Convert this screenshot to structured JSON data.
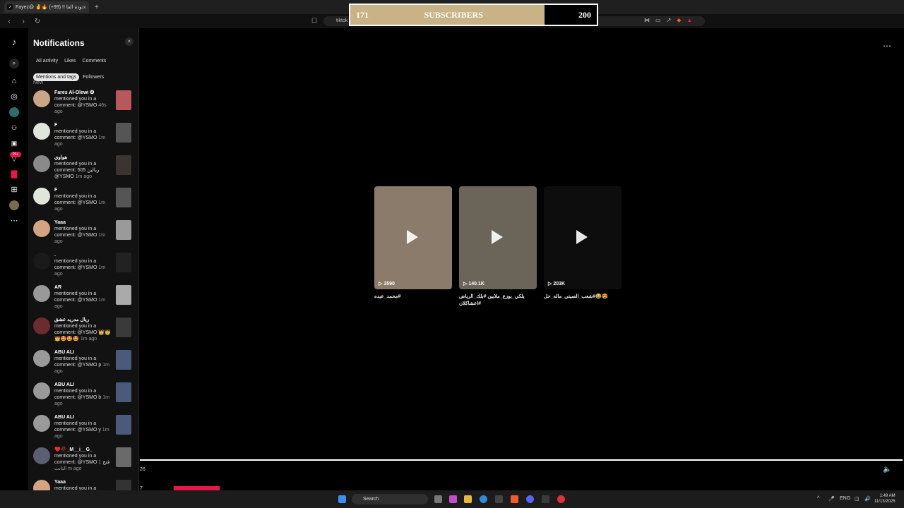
{
  "browser": {
    "tab_title": "Fayez@ ✌️🔥 عودة الفا !! (99+)",
    "url": "tiktok",
    "tab_icon": "tiktok-icon",
    "new_tab": "+",
    "close": "×"
  },
  "subscriber_banner": {
    "current": "171",
    "label": "SUBSCRIBERS",
    "goal": "200",
    "progress": 0.855,
    "fill_color": "#c9b285"
  },
  "notifications": {
    "title": "Notifications",
    "close_label": "×",
    "filters": [
      "All activity",
      "Likes",
      "Comments",
      "Mentions and tags",
      "Followers"
    ],
    "active_filter": "Mentions and tags",
    "section": "New",
    "items": [
      {
        "name": "Fares Al-Olewi ✪",
        "text": "mentioned you in a comment: @YSMO",
        "time": "46s ago",
        "avatar_color": "#c9a686",
        "thumb_color": "#b8585c"
      },
      {
        "name": "F",
        "text": "mentioned you in a comment: @YSMO",
        "time": "1m ago",
        "avatar_color": "#e0e6dc",
        "thumb_color": "#555555"
      },
      {
        "name": "هواوي",
        "text": "mentioned you in a comment: 505 ريالين @YSMO",
        "time": "1m ago",
        "avatar_color": "#8a8a8a",
        "thumb_color": "#3a3530"
      },
      {
        "name": "F",
        "text": "mentioned you in a comment: @YSMO",
        "time": "1m ago",
        "avatar_color": "#e0e6dc",
        "thumb_color": "#555555"
      },
      {
        "name": "Yaaa",
        "text": "mentioned you in a comment: @YSMO",
        "time": "1m ago",
        "avatar_color": "#d4a480",
        "thumb_color": "#9a9a9a"
      },
      {
        "name": ".",
        "text": "mentioned you in a comment: @YSMO",
        "time": "1m ago",
        "avatar_color": "#1a1a1a",
        "thumb_color": "#222222"
      },
      {
        "name": "AR",
        "text": "mentioned you in a comment: @YSMO",
        "time": "1m ago",
        "avatar_color": "#999999",
        "thumb_color": "#aaaaaa"
      },
      {
        "name": "ريال مدريد عشق",
        "text": "mentioned you in a comment: @YSMO 👑👑👑🤩🤩🤩",
        "time": "1m ago",
        "avatar_color": "#6a2c2c",
        "thumb_color": "#3a3a3a"
      },
      {
        "name": "ABU ALI",
        "text": "mentioned you in a comment: @YSMO p",
        "time": "1m ago",
        "avatar_color": "#9a9a9a",
        "thumb_color": "#4a5a7a"
      },
      {
        "name": "ABU ALI",
        "text": "mentioned you in a comment: @YSMO b",
        "time": "1m ago",
        "avatar_color": "#9a9a9a",
        "thumb_color": "#4a5a7a"
      },
      {
        "name": "ABU ALI",
        "text": "mentioned you in a comment: @YSMO y",
        "time": "1m ago",
        "avatar_color": "#9a9a9a",
        "thumb_color": "#4a5a7a"
      },
      {
        "name": "♥️🥀_M__i__G_",
        "text": "mentioned you in a comment: @YSMO فتح",
        "time": "1 الثانث m ago",
        "avatar_color": "#5a6070",
        "thumb_color": "#6a6a6a"
      },
      {
        "name": "Yaaa",
        "text": "mentioned you in a",
        "time": "",
        "avatar_color": "#d4a480",
        "thumb_color": "#333333"
      }
    ]
  },
  "rail_icons": [
    "tiktok-logo-icon",
    "search-icon",
    "home-icon",
    "explore-icon",
    "following-icon",
    "friends-icon",
    "live-icon",
    "inbox-icon",
    "message-icon",
    "upload-icon",
    "profile-icon",
    "more-icon"
  ],
  "rail_badge": "99+",
  "more_menu": "⋯",
  "videos": [
    {
      "views": "3590",
      "caption": "#محمد_عبده",
      "bg": "#8a7b6a"
    },
    {
      "views": "140.1K",
      "caption": "يلكي_يوزع_ملايين #بلك_الرياض #اعشاكلان",
      "bg": "#6b6458"
    },
    {
      "views": "203K",
      "caption": "😍😂#شعب_الصيني_ماله_حل",
      "bg": "#0d0d0d"
    }
  ],
  "player": {
    "time_left": "26",
    "small_num": "7"
  },
  "taskbar": {
    "search_label": "Search",
    "lang": "ENG",
    "time": "1:49 AM",
    "date": "11/13/2025"
  }
}
